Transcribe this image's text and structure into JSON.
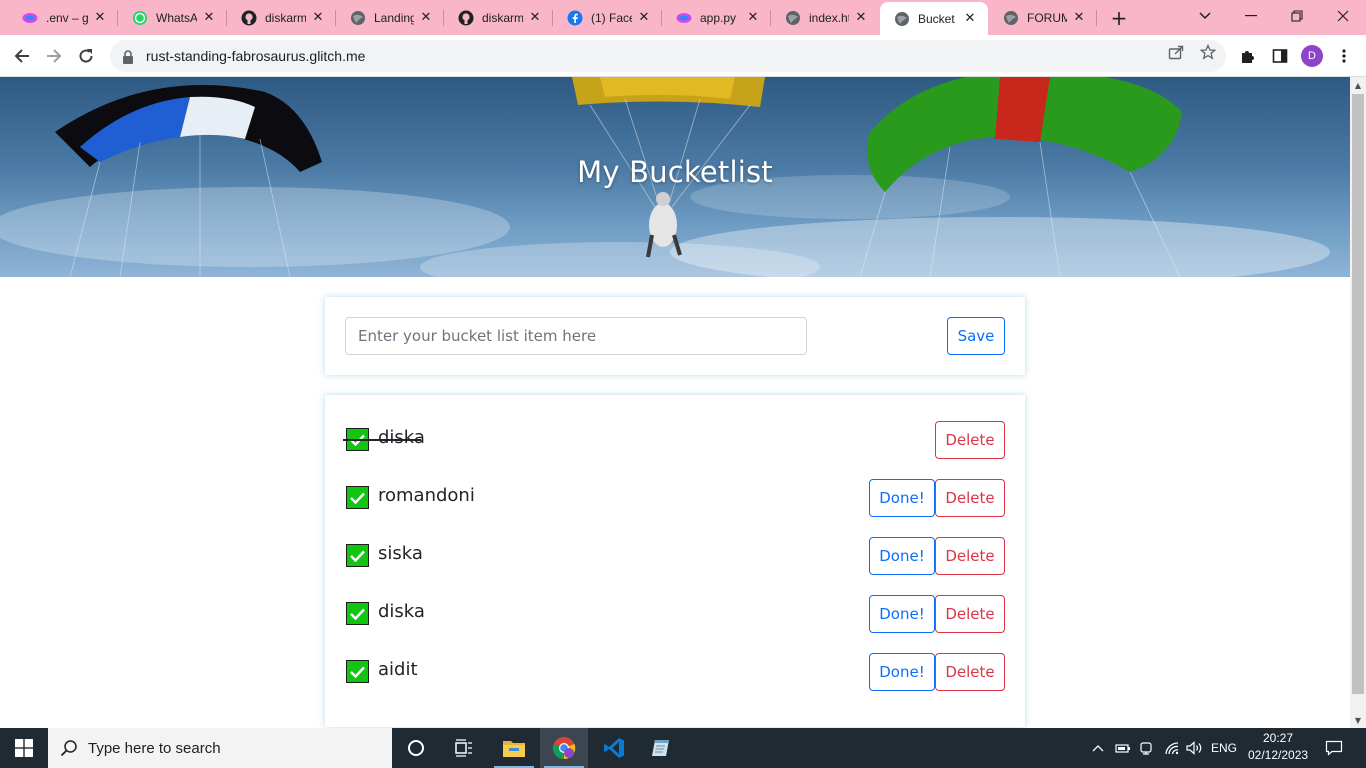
{
  "browser": {
    "tabs": [
      {
        "title": ".env – g",
        "icon": "glitch-icon"
      },
      {
        "title": "WhatsA",
        "icon": "whatsapp-icon"
      },
      {
        "title": "diskarm",
        "icon": "github-icon"
      },
      {
        "title": "Landing",
        "icon": "globe-icon"
      },
      {
        "title": "diskarm",
        "icon": "github-icon"
      },
      {
        "title": "(1) Face",
        "icon": "facebook-icon"
      },
      {
        "title": "app.py",
        "icon": "glitch-icon"
      },
      {
        "title": "index.ht",
        "icon": "globe-icon"
      },
      {
        "title": "Bucket",
        "icon": "globe-icon",
        "active": true
      },
      {
        "title": "FORUM",
        "icon": "globe-icon"
      }
    ],
    "url": "rust-standing-fabrosaurus.glitch.me",
    "profile_initial": "D",
    "profile_color": "#8e44c9",
    "tabstrip_color": "#f8b6c8"
  },
  "page": {
    "title": "My Bucketlist",
    "input_placeholder": "Enter your bucket list item here",
    "save_label": "Save",
    "done_label": "Done!",
    "delete_label": "Delete",
    "items": [
      {
        "text": "diska",
        "done": true
      },
      {
        "text": "romandoni",
        "done": false
      },
      {
        "text": "siska",
        "done": false
      },
      {
        "text": "diska",
        "done": false
      },
      {
        "text": "aidit",
        "done": false
      }
    ],
    "accent_primary": "#0d6efd",
    "accent_danger": "#dc3545",
    "checkbox_color": "#11c511"
  },
  "taskbar": {
    "search_placeholder": "Type here to search",
    "language": "ENG",
    "time": "20:27",
    "date": "02/12/2023"
  }
}
